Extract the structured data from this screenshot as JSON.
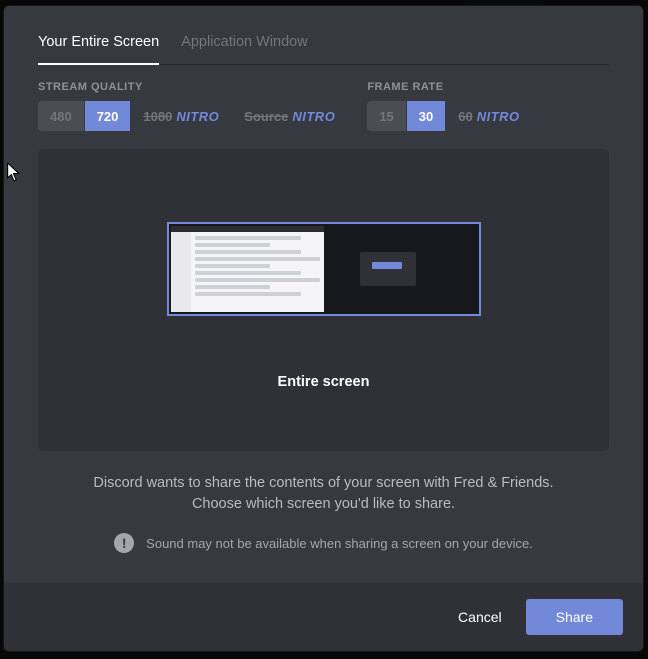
{
  "tabs": {
    "entire_screen": "Your Entire Screen",
    "app_window": "Application Window"
  },
  "quality": {
    "label": "STREAM QUALITY",
    "opt_480": "480",
    "opt_720": "720",
    "opt_1080": "1080",
    "opt_source": "Source",
    "nitro_badge": "NITRO"
  },
  "framerate": {
    "label": "FRAME RATE",
    "opt_15": "15",
    "opt_30": "30",
    "opt_60": "60",
    "nitro_badge": "NITRO"
  },
  "preview": {
    "caption": "Entire screen"
  },
  "description": {
    "line1": "Discord wants to share the contents of your screen with Fred & Friends.",
    "line2": "Choose which screen you'd like to share."
  },
  "warning": {
    "text": "Sound may not be available when sharing a screen on your device.",
    "icon_glyph": "!"
  },
  "buttons": {
    "cancel": "Cancel",
    "share": "Share"
  }
}
